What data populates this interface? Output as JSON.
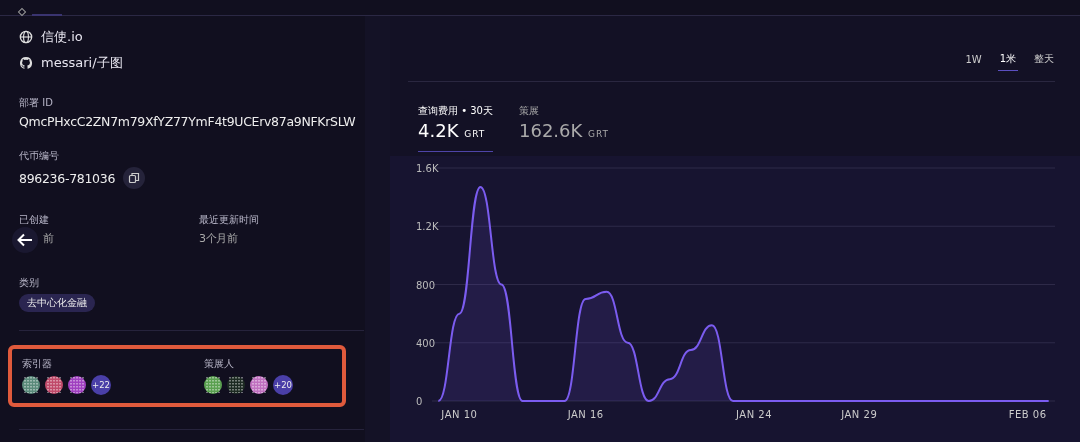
{
  "links": [
    {
      "kind": "website",
      "label": "信使.io"
    },
    {
      "kind": "github",
      "label": "messari/子图"
    }
  ],
  "deployment": {
    "label": "部署 ID",
    "value": "QmcPHxcC2ZN7m79XfYZ77YmF4t9UCErv87a9NFKrSLW"
  },
  "token": {
    "label": "代币编号",
    "value": "896236-781036"
  },
  "created": {
    "label": "已创建",
    "value": "前"
  },
  "updated": {
    "label": "最近更新时间",
    "value": "3个月前"
  },
  "category": {
    "label": "类别",
    "tag": "去中心化金融"
  },
  "contributors": {
    "highlighted": true,
    "groups": [
      {
        "label": "索引器",
        "avatars": [
          {
            "color": "#5a8a7a"
          },
          {
            "color": "#c04a6a"
          },
          {
            "color": "#a040c0"
          }
        ],
        "more": "+22"
      },
      {
        "label": "策展人",
        "avatars": [
          {
            "color": "#5aa050"
          },
          {
            "color": "#1c2a22"
          },
          {
            "color": "#c070c0"
          }
        ],
        "more": "+20"
      }
    ]
  },
  "ranges": [
    {
      "label": "1W",
      "selected": false
    },
    {
      "label": "1米",
      "selected": true
    },
    {
      "label": "整天",
      "selected": false
    }
  ],
  "stats": [
    {
      "label": "查询费用 • 30天",
      "value": "4.2K",
      "unit": "GRT",
      "selected": true
    },
    {
      "label": "策展",
      "value": "162.6K",
      "unit": "GRT",
      "selected": false
    }
  ],
  "chart_data": {
    "type": "area",
    "categories": [
      null,
      "JAN 10",
      null,
      null,
      null,
      null,
      null,
      "JAN 16",
      null,
      null,
      null,
      null,
      null,
      null,
      null,
      "JAN 24",
      null,
      null,
      null,
      null,
      "JAN 29",
      null,
      null,
      null,
      null,
      null,
      null,
      null,
      "FEB 06",
      null
    ],
    "series": [
      {
        "color": "#7b5cf0",
        "values": [
          0,
          600,
          1470,
          800,
          0,
          0,
          0,
          700,
          750,
          400,
          0,
          150,
          350,
          520,
          0,
          0,
          0,
          0,
          0,
          0,
          0,
          0,
          0,
          0,
          0,
          0,
          0,
          0,
          0,
          0
        ]
      }
    ],
    "ylim": [
      0,
      1600
    ],
    "grid": true,
    "yticks": [
      {
        "value": 0,
        "label": "0"
      },
      {
        "value": 400,
        "label": "400"
      },
      {
        "value": 800,
        "label": "800"
      },
      {
        "value": 1200,
        "label": "1.2K"
      },
      {
        "value": 1600,
        "label": "1.6K"
      }
    ]
  }
}
